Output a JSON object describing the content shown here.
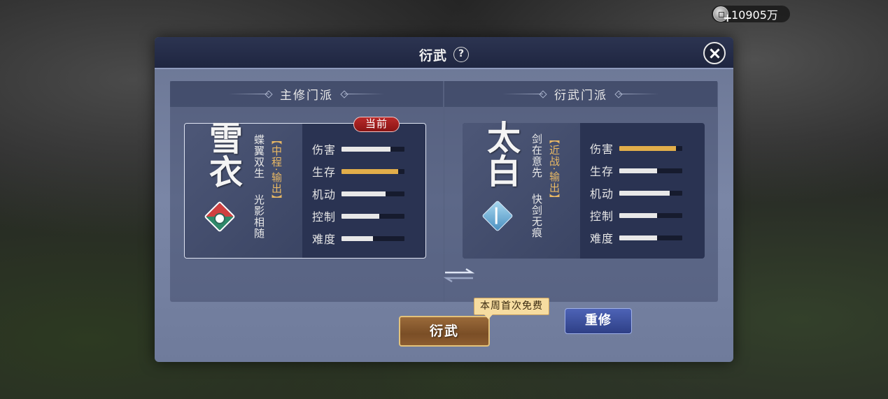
{
  "currency": {
    "amount": "10905万",
    "icon": "silver-coin-icon",
    "plus": "+"
  },
  "dialog": {
    "title": "衍武",
    "help_symbol": "?",
    "sections": {
      "main": "主修门派",
      "target": "衍武门派"
    },
    "current_badge": "当前",
    "main_school": {
      "name": "雪衣",
      "role": "【中程·输出】",
      "motto_1": "蝶翼双生",
      "motto_2": "光影相随",
      "emblem": "xueyi-emblem-icon",
      "stats": [
        {
          "label": "伤害",
          "value": 0.78,
          "highlight": false
        },
        {
          "label": "生存",
          "value": 0.9,
          "highlight": true
        },
        {
          "label": "机动",
          "value": 0.7,
          "highlight": false
        },
        {
          "label": "控制",
          "value": 0.6,
          "highlight": false
        },
        {
          "label": "难度",
          "value": 0.5,
          "highlight": false
        }
      ]
    },
    "target_school": {
      "name": "太白",
      "role": "【近战·输出】",
      "motto_1": "剑在意先",
      "motto_2": "快剑无痕",
      "emblem": "taibai-emblem-icon",
      "stats": [
        {
          "label": "伤害",
          "value": 0.9,
          "highlight": true
        },
        {
          "label": "生存",
          "value": 0.6,
          "highlight": false
        },
        {
          "label": "机动",
          "value": 0.8,
          "highlight": false
        },
        {
          "label": "控制",
          "value": 0.6,
          "highlight": false
        },
        {
          "label": "难度",
          "value": 0.6,
          "highlight": false
        }
      ]
    },
    "relearn_label": "重修",
    "free_tag": "本周首次免费",
    "confirm_label": "衍武"
  },
  "colors": {
    "highlight": "#e2ae4a",
    "normal_bar": "#e8e8e8",
    "badge": "#b82a2a"
  }
}
